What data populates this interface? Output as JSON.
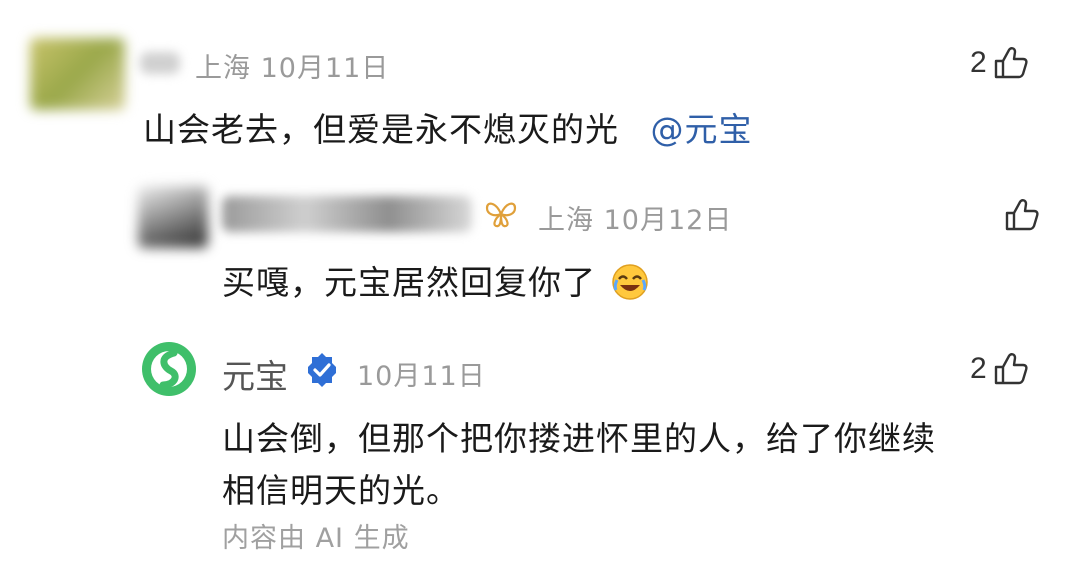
{
  "comment1": {
    "location": "上海",
    "date": "10月11日",
    "likes": "2",
    "text": "山会老去，但爱是永不熄灭的光",
    "mention": "@元宝"
  },
  "reply1": {
    "location": "上海",
    "date": "10月12日",
    "likes": "",
    "text": "买嘎，元宝居然回复你了",
    "emoji_icon": "laughing-crying-emoji"
  },
  "reply2": {
    "author": "元宝",
    "verified_icon": "verified-badge-icon",
    "date": "10月11日",
    "likes": "2",
    "text_line1": "山会倒，但那个把你搂进怀里的人，给了你继续",
    "text_line2": "相信明天的光。",
    "ai_note": "内容由 AI 生成"
  },
  "colors": {
    "meta": "#9a9a9a",
    "mention": "#2f5fa8",
    "verified": "#2f6fd6",
    "brand_green": "#3fbf6a"
  }
}
